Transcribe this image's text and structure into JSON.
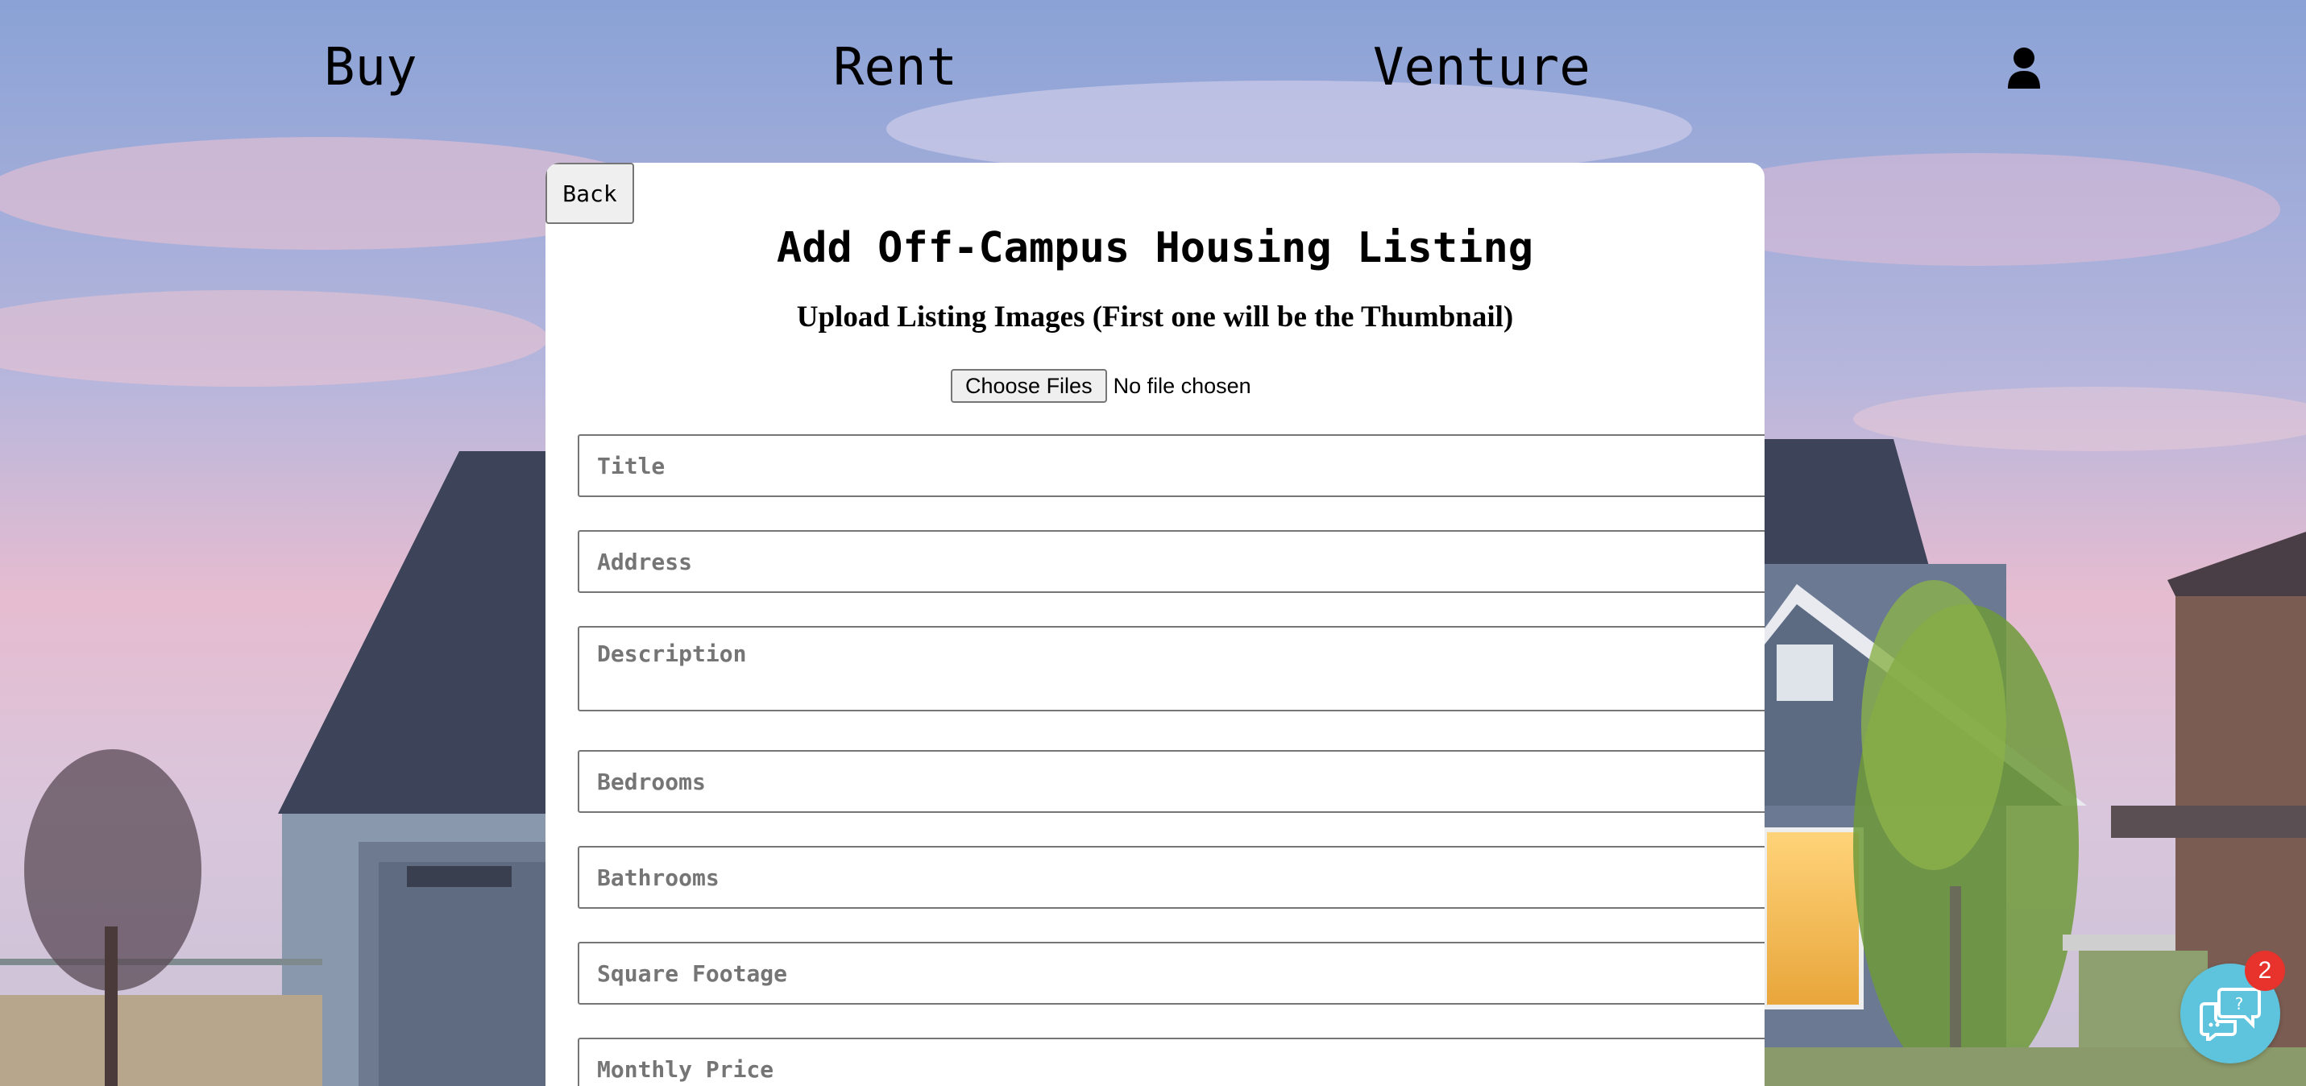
{
  "nav": {
    "buy": "Buy",
    "rent": "Rent",
    "venture": "Venture",
    "account_icon": "person-icon"
  },
  "form": {
    "back_label": "Back",
    "title": "Add Off-Campus Housing Listing",
    "upload_heading": "Upload Listing Images (First one will be the Thumbnail)",
    "choose_files_label": "Choose Files",
    "file_status": "No file chosen",
    "fields": {
      "title_placeholder": "Title",
      "address_placeholder": "Address",
      "description_placeholder": "Description",
      "bedrooms_placeholder": "Bedrooms",
      "bathrooms_placeholder": "Bathrooms",
      "square_footage_placeholder": "Square Footage",
      "monthly_price_placeholder": "Monthly Price"
    }
  },
  "chat": {
    "icon": "chat-help-icon",
    "badge_count": "2"
  },
  "colors": {
    "sky_top": "#8ea6d8",
    "sky_pink": "#e8b8cc",
    "house_siding": "#6b7a90",
    "roof": "#3b4258",
    "chat_accent": "#5ec3dc",
    "badge": "#e8322c"
  }
}
